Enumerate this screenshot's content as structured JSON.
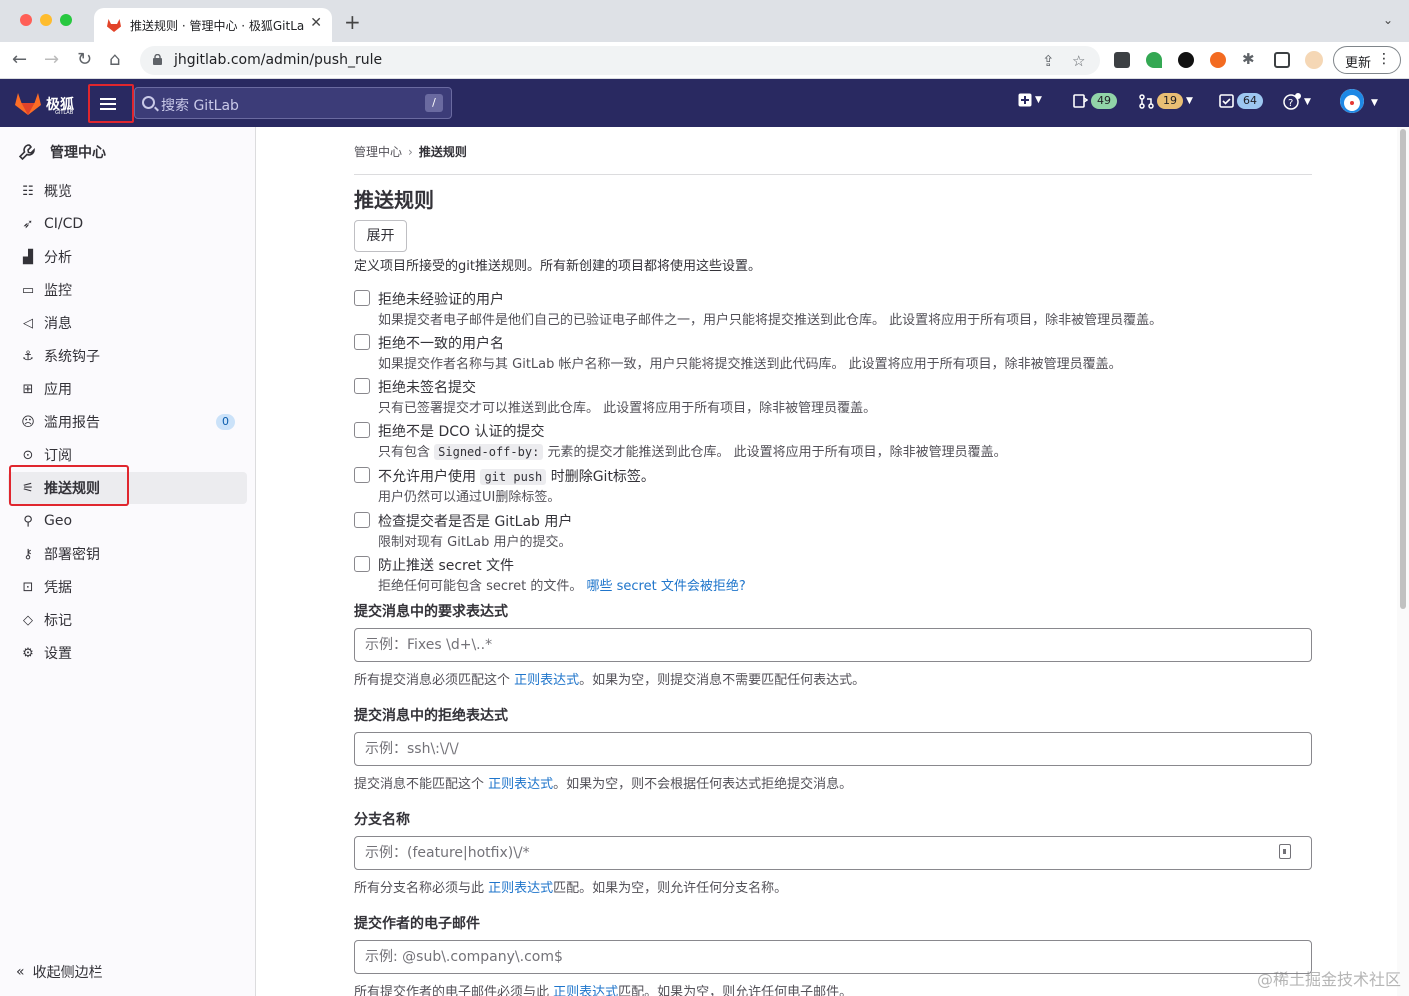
{
  "browser": {
    "tab_title": "推送规则 · 管理中心 · 极狐GitLab",
    "tab_close": "✕",
    "new_tab": "+",
    "url": "jhgitlab.com/admin/push_rule",
    "update_label": "更新"
  },
  "header": {
    "brand": "极狐",
    "brand_sub": "GITLAB",
    "search_placeholder": "搜索 GitLab",
    "search_shortcut": "/",
    "issues_count": "49",
    "merge_requests_count": "19",
    "todos_count": "64"
  },
  "sidebar": {
    "title": "管理中心",
    "items": [
      {
        "label": "概览",
        "icon": "overview-icon"
      },
      {
        "label": "CI/CD",
        "icon": "rocket-icon"
      },
      {
        "label": "分析",
        "icon": "chart-icon"
      },
      {
        "label": "监控",
        "icon": "monitor-icon"
      },
      {
        "label": "消息",
        "icon": "bullhorn-icon"
      },
      {
        "label": "系统钩子",
        "icon": "hook-icon"
      },
      {
        "label": "应用",
        "icon": "apps-icon"
      },
      {
        "label": "滥用报告",
        "icon": "abuse-icon",
        "count": "0"
      },
      {
        "label": "订阅",
        "icon": "subscription-icon"
      },
      {
        "label": "推送规则",
        "icon": "push-rules-icon",
        "active": true
      },
      {
        "label": "Geo",
        "icon": "location-icon"
      },
      {
        "label": "部署密钥",
        "icon": "key-icon"
      },
      {
        "label": "凭据",
        "icon": "lock-icon"
      },
      {
        "label": "标记",
        "icon": "label-icon"
      },
      {
        "label": "设置",
        "icon": "settings-icon"
      }
    ],
    "collapse_label": "收起侧边栏"
  },
  "main": {
    "breadcrumb_root": "管理中心",
    "breadcrumb_current": "推送规则",
    "title": "推送规则",
    "expand_label": "展开",
    "description": "定义项目所接受的git推送规则。所有新创建的项目都将使用这些设置。",
    "rules": [
      {
        "label": "拒绝未经验证的用户",
        "help": "如果提交者电子邮件是他们自己的已验证电子邮件之一，用户只能将提交推送到此仓库。 此设置将应用于所有项目，除非被管理员覆盖。"
      },
      {
        "label": "拒绝不一致的用户名",
        "help": "如果提交作者名称与其 GitLab 帐户名称一致，用户只能将提交推送到此代码库。 此设置将应用于所有项目，除非被管理员覆盖。"
      },
      {
        "label": "拒绝未签名提交",
        "help": "只有已签署提交才可以推送到此仓库。 此设置将应用于所有项目，除非被管理员覆盖。"
      },
      {
        "label": "拒绝不是 DCO 认证的提交",
        "help_pre": "只有包含",
        "help_code": "Signed-off-by:",
        "help_post": "元素的提交才能推送到此仓库。 此设置将应用于所有项目，除非被管理员覆盖。"
      },
      {
        "label_pre": "不允许用户使用",
        "label_code": "git push",
        "label_post": "时删除Git标签。",
        "help": "用户仍然可以通过UI删除标签。"
      },
      {
        "label": "检查提交者是否是 GitLab 用户",
        "help": "限制对现有 GitLab 用户的提交。"
      },
      {
        "label": "防止推送 secret 文件",
        "help": "拒绝任何可能包含 secret 的文件。",
        "help_link": "哪些 secret 文件会被拒绝?"
      }
    ],
    "fields": [
      {
        "label": "提交消息中的要求表达式",
        "placeholder": "示例：Fixes \\d+\\..*",
        "help_pre": "所有提交消息必须匹配这个",
        "help_link": "正则表达式",
        "help_post": "。如果为空，则提交消息不需要匹配任何表达式。"
      },
      {
        "label": "提交消息中的拒绝表达式",
        "placeholder": "示例：ssh\\:\\/\\/",
        "help_pre": "提交消息不能匹配这个",
        "help_link": "正则表达式",
        "help_post": "。如果为空，则不会根据任何表达式拒绝提交消息。"
      },
      {
        "label": "分支名称",
        "placeholder": "示例：(feature|hotfix)\\/*",
        "help_pre": "所有分支名称必须与此",
        "help_link": "正则表达式",
        "help_post": "匹配。如果为空，则允许任何分支名称。"
      },
      {
        "label": "提交作者的电子邮件",
        "placeholder": "示例: @sub\\.company\\.com$",
        "help_pre": "所有提交作者的电子邮件必须与此",
        "help_link": "正则表达式",
        "help_post": "匹配。如果为空，则允许任何电子邮件。"
      }
    ]
  },
  "watermark": "@稀土掘金技术社区",
  "colors": {
    "header_bg": "#292961",
    "link": "#1f75cb",
    "highlight_box": "#e0262e"
  }
}
